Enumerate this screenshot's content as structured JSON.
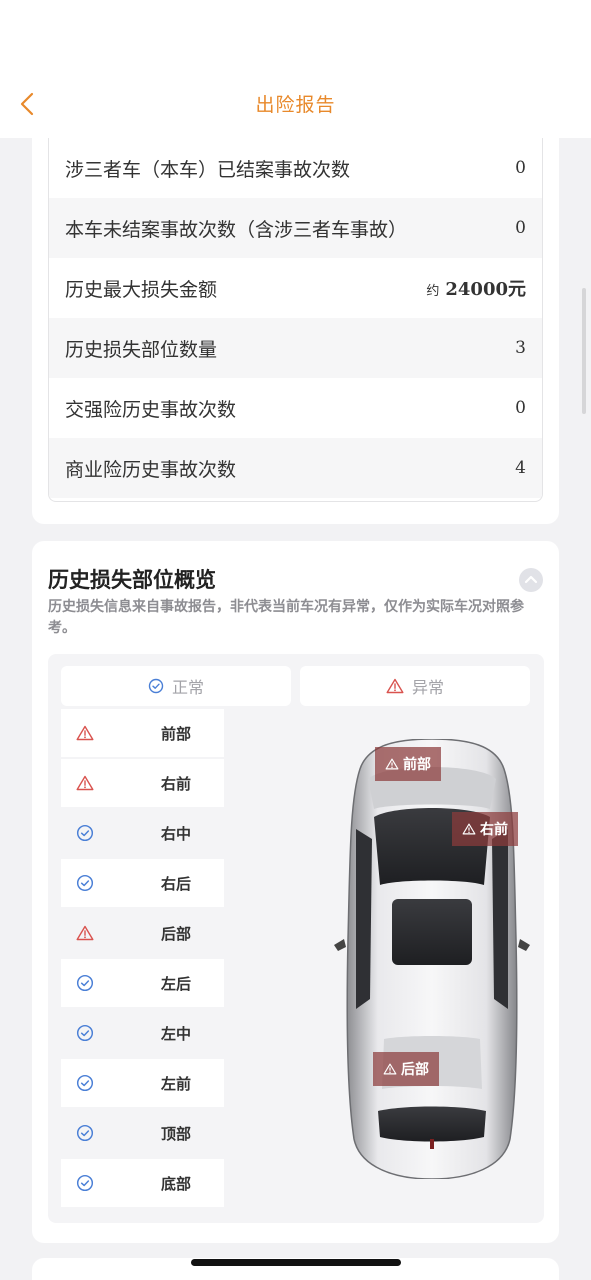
{
  "nav": {
    "title": "出险报告"
  },
  "summary_rows": [
    {
      "label": "涉三者车（本车）已结案事故次数",
      "value": "0"
    },
    {
      "label": "本车未结案事故次数（含涉三者车事故）",
      "value": "0"
    },
    {
      "label": "历史最大损失金额",
      "prefix": "约",
      "value": "24000元"
    },
    {
      "label": "历史损失部位数量",
      "value": "3"
    },
    {
      "label": "交强险历史事故次数",
      "value": "0"
    },
    {
      "label": "商业险历史事故次数",
      "value": "4"
    }
  ],
  "overview": {
    "title": "历史损失部位概览",
    "note": "历史损失信息来自事故报告，非代表当前车况有异常，仅作为实际车况对照参考。",
    "legend_normal": "正常",
    "legend_abnormal": "异常"
  },
  "parts": [
    {
      "name": "前部",
      "status": "abnormal"
    },
    {
      "name": "右前",
      "status": "abnormal"
    },
    {
      "name": "右中",
      "status": "normal"
    },
    {
      "name": "右后",
      "status": "normal"
    },
    {
      "name": "后部",
      "status": "abnormal"
    },
    {
      "name": "左后",
      "status": "normal"
    },
    {
      "name": "左中",
      "status": "normal"
    },
    {
      "name": "左前",
      "status": "normal"
    },
    {
      "name": "顶部",
      "status": "normal"
    },
    {
      "name": "底部",
      "status": "normal"
    }
  ],
  "car_tags": {
    "front": "前部",
    "right_front": "右前",
    "rear": "后部"
  },
  "colors": {
    "accent": "#e8892b",
    "normal": "#4a7fd6",
    "abnormal": "#d9534f",
    "tag_bg": "#8c3c3c"
  },
  "icons": {
    "back": "chevron-left-icon",
    "collapse": "chevron-up-icon",
    "normal": "check-circle-icon",
    "abnormal": "warning-triangle-icon"
  }
}
